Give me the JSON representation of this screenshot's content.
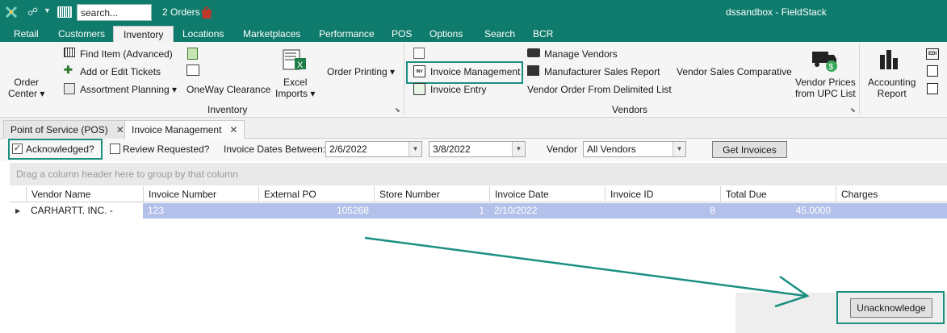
{
  "titlebar": {
    "search_placeholder": "search...",
    "orders": "2 Orders",
    "app_title": "dssandbox - FieldStack"
  },
  "menu": {
    "tabs": [
      "Retail",
      "Customers",
      "Inventory",
      "Locations",
      "Marketplaces",
      "Performance",
      "POS",
      "Options",
      "Search",
      "BCR"
    ],
    "active": "Inventory"
  },
  "ribbon": {
    "order_center": "Order\nCenter ▾",
    "find_item": "Find Item (Advanced)",
    "add_edit_tickets": "Add or Edit Tickets",
    "assortment_planning": "Assortment Planning ▾",
    "oneway_clearance": "OneWay Clearance",
    "excel_imports": "Excel\nImports ▾",
    "order_printing": "Order Printing ▾",
    "inventory_group": "Inventory",
    "invoice_management": "Invoice Management",
    "invoice_entry": "Invoice Entry",
    "manage_vendors": "Manage Vendors",
    "manufacturer_sales_report": "Manufacturer Sales Report",
    "vendor_order_delimited": "Vendor Order From Delimited List",
    "vendor_sales_comparative": "Vendor Sales Comparative",
    "vendor_prices_upc": "Vendor Prices\nfrom UPC List",
    "vendors_group": "Vendors",
    "accounting_report": "Accounting\nReport"
  },
  "doc_tabs": [
    {
      "label": "Point of Service (POS)",
      "close": "✕"
    },
    {
      "label": "Invoice Management",
      "close": "✕"
    }
  ],
  "filters": {
    "acknowledged_label": "Acknowledged?",
    "acknowledged_checked": true,
    "review_label": "Review Requested?",
    "review_checked": false,
    "dates_label": "Invoice Dates Between:",
    "date_from": "2/6/2022",
    "date_to": "3/8/2022",
    "vendor_label": "Vendor",
    "vendor_value": "All Vendors",
    "get_invoices": "Get Invoices"
  },
  "grid": {
    "group_hint": "Drag a column header here to group by that column",
    "columns": [
      "Vendor Name",
      "Invoice Number",
      "External PO",
      "Store Number",
      "Invoice Date",
      "Invoice ID",
      "Total Due",
      "Charges"
    ],
    "rows": [
      [
        "CARHARTT. INC. -",
        "123",
        "105268",
        "1",
        "2/10/2022",
        "8",
        "45.0000",
        ""
      ]
    ]
  },
  "bottom": {
    "unacknowledge": "Unacknowledge"
  },
  "colors": {
    "brand": "#0f7b6c",
    "highlight": "#1a8f80",
    "selected_row": "#b3c0ea"
  }
}
